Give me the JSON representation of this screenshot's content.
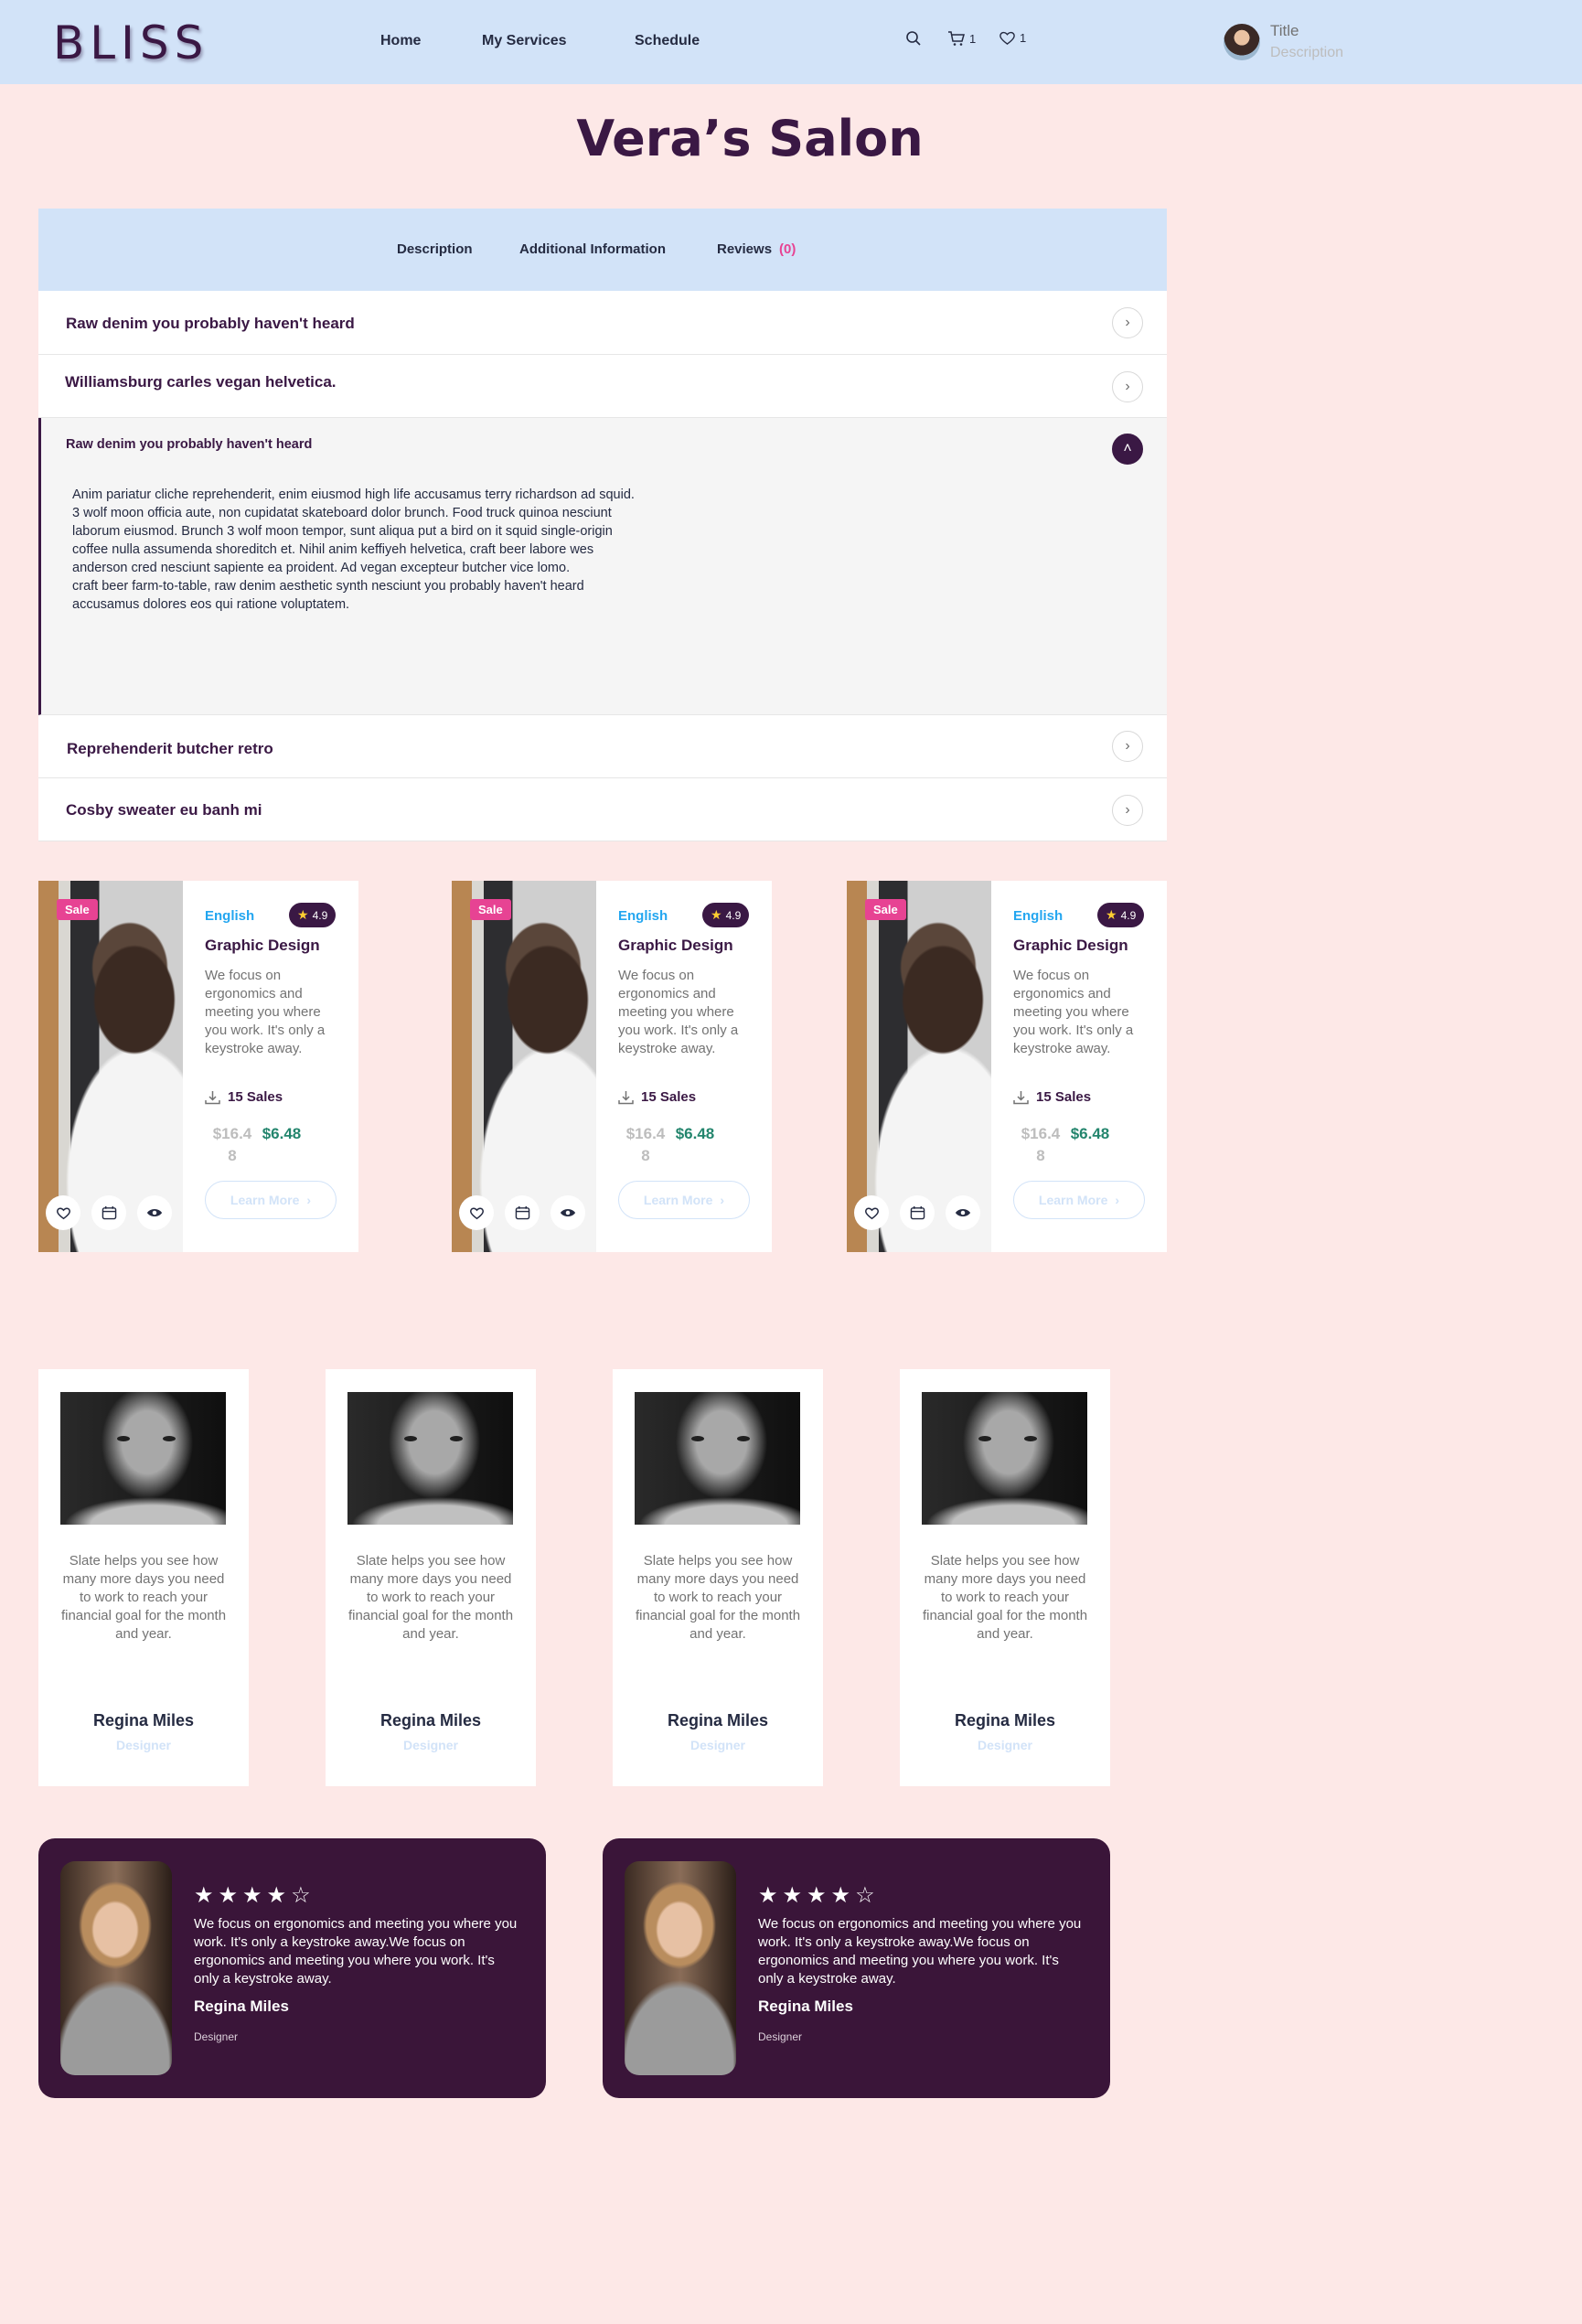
{
  "header": {
    "logo": "BLISS",
    "nav": [
      "Home",
      "My Services",
      "Schedule"
    ],
    "cart_count": "1",
    "wishlist_count": "1",
    "profile": {
      "title": "Title",
      "description": "Description"
    }
  },
  "page": {
    "title": "Vera’s Salon"
  },
  "tabs": {
    "description": "Description",
    "additional": "Additional Information",
    "reviews": "Reviews",
    "reviews_count": "(0)"
  },
  "accordion": [
    {
      "title": "Raw denim you probably haven't heard"
    },
    {
      "title": "Williamsburg carles vegan helvetica."
    },
    {
      "title": "Raw denim you probably haven't heard",
      "body": "Anim pariatur cliche reprehenderit, enim eiusmod high life accusamus terry richardson ad squid.\n3 wolf moon officia aute, non cupidatat skateboard dolor brunch. Food truck quinoa nesciunt\n laborum eiusmod. Brunch 3 wolf moon tempor, sunt aliqua put a bird on it squid single-origin\ncoffee nulla assumenda shoreditch et. Nihil anim keffiyeh helvetica, craft beer labore wes\nanderson cred nesciunt sapiente ea proident. Ad vegan excepteur butcher vice lomo.\ncraft beer farm-to-table, raw denim aesthetic synth nesciunt you probably haven't heard\naccusamus dolores eos qui ratione voluptatem."
    },
    {
      "title": "Reprehenderit butcher retro"
    },
    {
      "title": "Cosby sweater eu banh mi"
    }
  ],
  "products": [
    {
      "badge": "Sale",
      "language": "English",
      "rating": "4.9",
      "title": "Graphic Design",
      "description": "We focus on ergonomics and meeting you where you work. It's only a keystroke away.",
      "sales": "15 Sales",
      "old_price": "$16.48",
      "new_price": "$6.48",
      "cta": "Learn More"
    },
    {
      "badge": "Sale",
      "language": "English",
      "rating": "4.9",
      "title": "Graphic Design",
      "description": "We focus on ergonomics and meeting you where you work. It's only a keystroke away.",
      "sales": "15 Sales",
      "old_price": "$16.48",
      "new_price": "$6.48",
      "cta": "Learn More"
    },
    {
      "badge": "Sale",
      "language": "English",
      "rating": "4.9",
      "title": "Graphic Design",
      "description": "We focus on ergonomics and meeting you where you work. It's only a keystroke away.",
      "sales": "15 Sales",
      "old_price": "$16.48",
      "new_price": "$6.48",
      "cta": "Learn More"
    }
  ],
  "team": [
    {
      "quote": "Slate helps you see how many more days you need to work to reach your financial goal for the month and year.",
      "name": "Regina Miles",
      "role": "Designer"
    },
    {
      "quote": "Slate helps you see how many more days you need to work to reach your financial goal for the month and year.",
      "name": "Regina Miles",
      "role": "Designer"
    },
    {
      "quote": "Slate helps you see how many more days you need to work to reach your financial goal for the month and year.",
      "name": "Regina Miles",
      "role": "Designer"
    },
    {
      "quote": "Slate helps you see how many more days you need to work to reach your financial goal for the month and year.",
      "name": "Regina Miles",
      "role": "Designer"
    }
  ],
  "reviews": [
    {
      "rating": 4,
      "max": 5,
      "text": "We focus on ergonomics and meeting you where you work. It's only a keystroke away.We focus on ergonomics and meeting you where you work. It's only a keystroke away.",
      "name": "Regina Miles",
      "role": "Designer"
    },
    {
      "rating": 4,
      "max": 5,
      "text": "We focus on ergonomics and meeting you where you work. It's only a keystroke away.We focus on ergonomics and meeting you where you work. It's only a keystroke away.",
      "name": "Regina Miles",
      "role": "Designer"
    }
  ],
  "colors": {
    "header_bg": "#d2e3f8",
    "page_bg": "#fde8e7",
    "brand": "#3a1844",
    "accent_pink": "#e74393",
    "accent_blue": "#23a6f0",
    "price_green": "#23856d"
  },
  "icons": [
    "search-icon",
    "cart-icon",
    "heart-icon",
    "chevron-right-icon",
    "chevron-up-icon",
    "star-icon",
    "download-icon",
    "calendar-icon",
    "eye-icon"
  ]
}
